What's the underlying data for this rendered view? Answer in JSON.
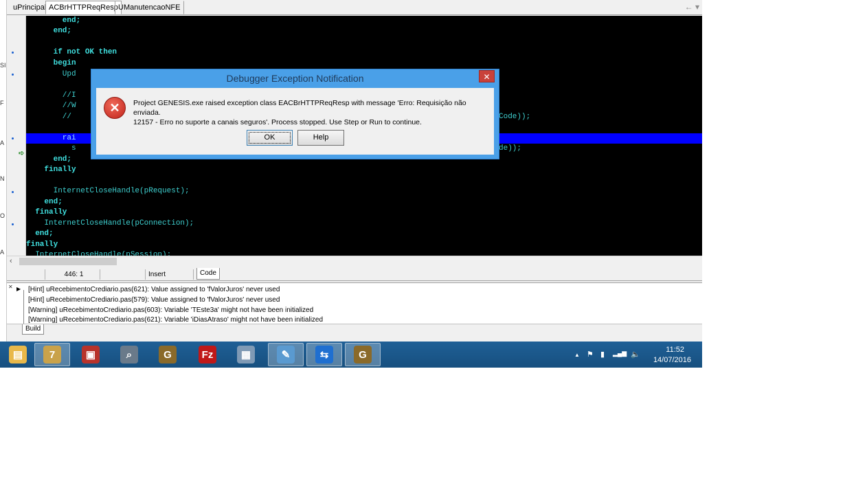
{
  "tabs": [
    {
      "label": "uPrincipal"
    },
    {
      "label": "ACBrHTTPReqResp",
      "active": true
    },
    {
      "label": "UManutencaoNFE"
    }
  ],
  "tab_nav": {
    "back": "←",
    "menu": "▾"
  },
  "code": {
    "lines": [
      "        end;",
      "      end;",
      "",
      "      if not OK then",
      "      begin",
      "        Upd",
      "",
      "        //I",
      "        //W",
      "        //",
      "",
      "        rai",
      "          s",
      "      end;",
      "    finally",
      "",
      "      InternetCloseHandle(pRequest);",
      "    end;",
      "  finally",
      "    InternetCloseHandle(pConnection);",
      "  end;",
      "finally",
      "  InternetCloseHandle(pSession);"
    ],
    "right_fragments": [
      "Code));",
      "de));"
    ]
  },
  "status": {
    "position": "446:  1",
    "mode": "Insert",
    "code_tab": "Code"
  },
  "messages": [
    "[Hint] uRecebimentoCrediario.pas(621): Value assigned to 'fValorJuros' never used",
    "[Hint] uRecebimentoCrediario.pas(579): Value assigned to 'fValorJuros' never used",
    "[Warning] uRecebimentoCrediario.pas(603): Variable 'TEste3a' might not have been initialized",
    "[Warning] uRecebimentoCrediario.pas(621): Variable 'iDiasAtraso' might not have been initialized"
  ],
  "build_tab": "Build",
  "dialog": {
    "title": "Debugger Exception Notification",
    "close": "✕",
    "message_line1": "Project GENESIS.exe raised exception class EACBrHTTPReqResp with message 'Erro: Requisição não enviada.",
    "message_line2": "12157 - Erro no suporte a canais seguros'. Process stopped. Use Step or Run to continue.",
    "ok": "OK",
    "help": "Help"
  },
  "taskbar": {
    "apps": [
      {
        "name": "file-explorer-icon",
        "glyph": "▤",
        "color": "#e8b84a"
      },
      {
        "name": "delphi-7-icon",
        "glyph": "7",
        "color": "#c9a24a",
        "active": true
      },
      {
        "name": "toolbox-icon",
        "glyph": "▣",
        "color": "#b8332b"
      },
      {
        "name": "search-document-icon",
        "glyph": "⌕",
        "color": "#6a7a8a"
      },
      {
        "name": "genesis-icon",
        "glyph": "G",
        "color": "#8a6a2a"
      },
      {
        "name": "filezilla-icon",
        "glyph": "Fz",
        "color": "#c01818"
      },
      {
        "name": "calculator-icon",
        "glyph": "▦",
        "color": "#7f9ab5"
      },
      {
        "name": "notepad-icon",
        "glyph": "✎",
        "color": "#5a9ad0",
        "active": true
      },
      {
        "name": "teamviewer-icon",
        "glyph": "⇆",
        "color": "#1f6fd0",
        "active": true
      },
      {
        "name": "genesis-icon-2",
        "glyph": "G",
        "color": "#8a6a2a",
        "active": true
      }
    ],
    "tray": {
      "chevron": "▲",
      "time": "11:52",
      "date": "14/07/2016"
    }
  },
  "left_strip": [
    "SI",
    "F",
    "A",
    "N",
    "O",
    "A"
  ]
}
